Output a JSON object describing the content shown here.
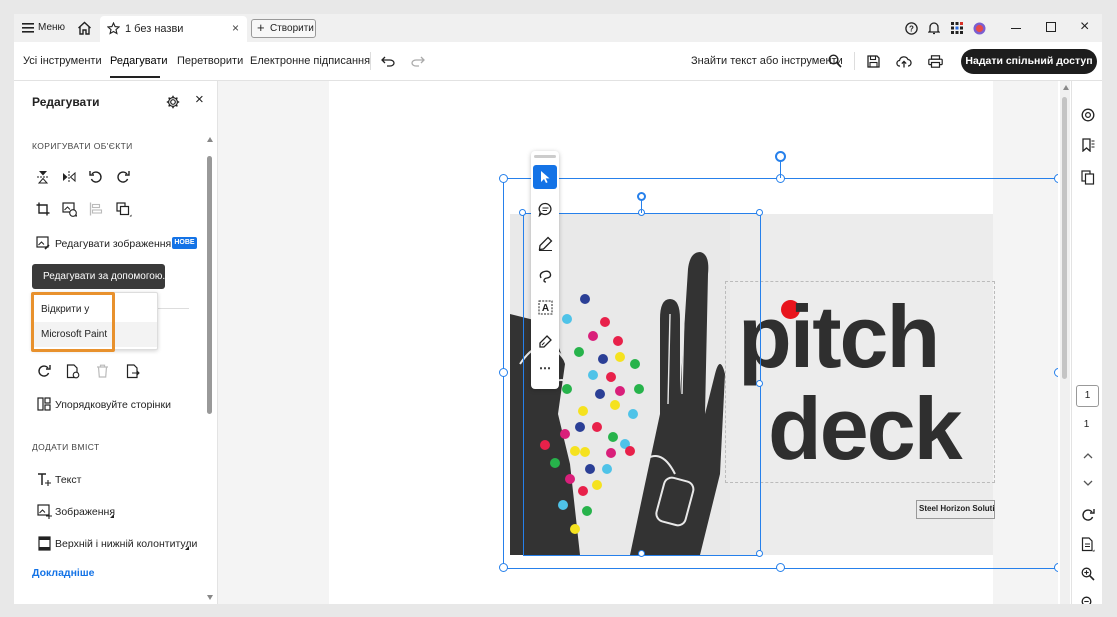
{
  "titlebar": {
    "menu_label": "Меню",
    "tab_title": "1 без назви",
    "create_label": "Створити"
  },
  "toolbar": {
    "tabs": [
      "Усі інструменти",
      "Редагувати",
      "Перетворити",
      "Електронне підписання"
    ],
    "active_tab": "Редагувати",
    "search_text": "Знайти текст або інструменти",
    "share_button": "Надати спільний доступ"
  },
  "left_panel": {
    "title": "Редагувати",
    "section_adjust": "КОРИГУВАТИ ОБ'ЄКТИ",
    "edit_image_label": "Редагувати зображення",
    "new_badge": "НОВЕ",
    "edit_with_button": "Редагувати за допомогою...",
    "dropdown": {
      "header": "Відкрити у",
      "item": "Microsoft Paint"
    },
    "organize_label": "Упорядковуйте сторінки",
    "section_add": "ДОДАТИ ВМІСТ",
    "add_text": "Текст",
    "add_image": "Зображення",
    "header_footer": "Верхній і нижній колонтитули",
    "more_link": "Докладніше"
  },
  "document": {
    "headline_line1": "pitch",
    "headline_line2": "deck",
    "company": "Steel Horizon Soluti"
  },
  "page_nav": {
    "current_page": "1",
    "total_pages": "1"
  },
  "colors": {
    "accent_blue": "#1473e6",
    "highlight_orange": "#e8912d",
    "dark_button": "#1d1d1d",
    "selection": "#2680eb"
  }
}
